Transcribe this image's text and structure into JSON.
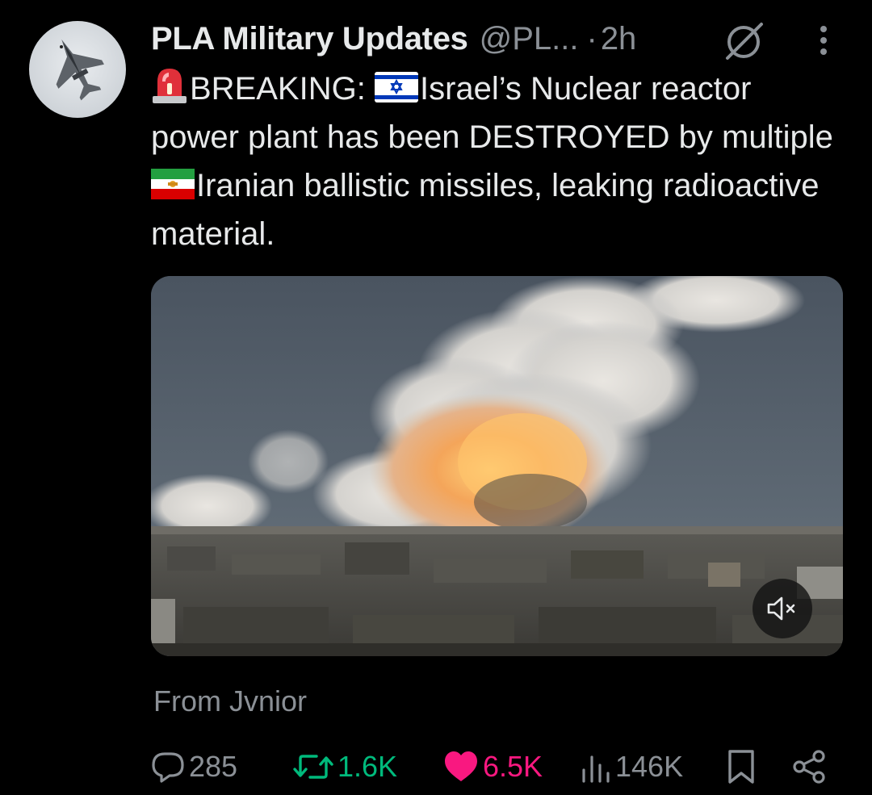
{
  "post": {
    "author_name": "PLA Military Updates",
    "author_handle": "@PL...",
    "separator": "·",
    "time": "2h",
    "text": {
      "lead": "BREAKING: ",
      "part1": "Israel’s Nuclear reactor power plant has been DESTROYED by multiple",
      "part2": "Iranian ballistic missiles, leaking radioactive material."
    },
    "emojis": [
      "police-siren",
      "flag-israel",
      "flag-iran-lion-and-sun"
    ],
    "media": {
      "type": "video",
      "muted": true
    },
    "source_label": "From Jvnior"
  },
  "engagement": {
    "replies": "285",
    "reposts": "1.6K",
    "likes": "6.5K",
    "views": "146K",
    "liked": true,
    "reposted": true
  },
  "icons": [
    "grok-icon",
    "more-icon",
    "reply-icon",
    "repost-icon",
    "like-icon",
    "views-icon",
    "bookmark-icon",
    "share-icon",
    "mute-icon"
  ],
  "colors": {
    "background": "#000000",
    "text": "#e7e9ea",
    "secondary": "#8b9096",
    "repost_active": "#00ba7c",
    "like_active": "#f91880"
  }
}
